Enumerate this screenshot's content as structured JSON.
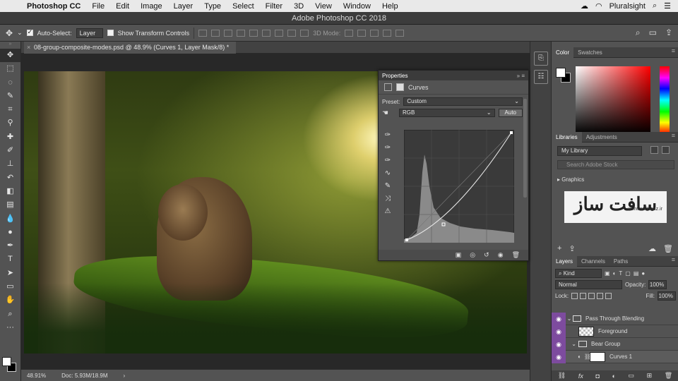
{
  "menubar": {
    "app": "Photoshop CC",
    "items": [
      "File",
      "Edit",
      "Image",
      "Layer",
      "Type",
      "Select",
      "Filter",
      "3D",
      "View",
      "Window",
      "Help"
    ],
    "right_brand": "Pluralsight"
  },
  "window": {
    "title": "Adobe Photoshop CC 2018"
  },
  "options": {
    "auto_select_label": "Auto-Select:",
    "auto_select_value": "Layer",
    "transform_label": "Show Transform Controls",
    "mode_3d": "3D Mode:"
  },
  "document": {
    "tab_label": "08-group-composite-modes.psd @ 48.9% (Curves 1, Layer Mask/8) *",
    "zoom": "48.91%",
    "doc_size": "Doc: 5.93M/18.9M"
  },
  "color_panel": {
    "tabs": [
      "Color",
      "Swatches"
    ]
  },
  "libraries_panel": {
    "tabs": [
      "Libraries",
      "Adjustments"
    ],
    "library": "My Library",
    "search_placeholder": "Search Adobe Stock",
    "section": "Graphics",
    "watermark_text": "سافت ساز",
    "watermark_sub": "www.softsaaz.ir"
  },
  "properties_panel": {
    "title": "Properties",
    "adjustment": "Curves",
    "preset_label": "Preset:",
    "preset_value": "Custom",
    "channel": "RGB",
    "auto_label": "Auto"
  },
  "layers_panel": {
    "tabs": [
      "Layers",
      "Channels",
      "Paths"
    ],
    "kind_label": "Kind",
    "blend_mode": "Normal",
    "opacity_label": "Opacity:",
    "opacity_value": "100%",
    "lock_label": "Lock:",
    "fill_label": "Fill:",
    "fill_value": "100%",
    "layers": [
      {
        "name": "Pass Through Blending",
        "type": "group"
      },
      {
        "name": "Foreground",
        "type": "pixel"
      },
      {
        "name": "Bear Group",
        "type": "group"
      },
      {
        "name": "Curves 1",
        "type": "adjustment"
      }
    ]
  },
  "icons": {
    "tools": [
      "move-icon",
      "marquee-icon",
      "lasso-icon",
      "quick-select-icon",
      "crop-icon",
      "eyedropper-icon",
      "healing-icon",
      "brush-icon",
      "stamp-icon",
      "history-brush-icon",
      "eraser-icon",
      "gradient-icon",
      "blur-icon",
      "dodge-icon",
      "pen-icon",
      "type-icon",
      "path-select-icon",
      "rectangle-icon",
      "hand-icon",
      "zoom-icon",
      "more-icon"
    ]
  },
  "colors": {
    "layer_visibility_accent": "#7d4b9e",
    "panel_bg": "#535353"
  }
}
